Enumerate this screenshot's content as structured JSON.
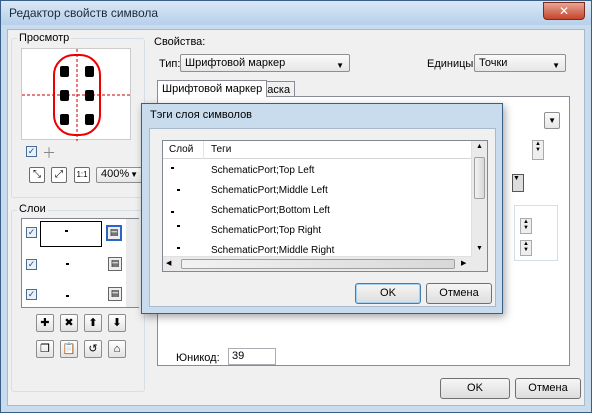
{
  "window": {
    "title": "Редактор свойств символа",
    "close_glyph": "✕"
  },
  "preview": {
    "label": "Просмотр",
    "zoom": "400%",
    "fit_glyph": "1:1"
  },
  "layers": {
    "label": "Слои"
  },
  "properties": {
    "label": "Свойства:",
    "type_label": "Тип:",
    "type_value": "Шрифтовой маркер",
    "units_label": "Единицы:",
    "units_value": "Точки",
    "tabs": [
      "Шрифтовой маркер",
      "Маска"
    ],
    "unicode_label": "Юникод:",
    "unicode_value": "39"
  },
  "footer": {
    "ok": "OK",
    "cancel": "Отмена"
  },
  "dialog": {
    "title": "Тэги слоя символов",
    "columns": [
      "Слой",
      "Теги"
    ],
    "rows": [
      {
        "tag": "SchematicPort;Top Left"
      },
      {
        "tag": "SchematicPort;Middle Left"
      },
      {
        "tag": "SchematicPort;Bottom Left"
      },
      {
        "tag": "SchematicPort;Top Right"
      },
      {
        "tag": "SchematicPort;Middle Right"
      }
    ],
    "ok": "OK",
    "cancel": "Отмена"
  },
  "colors": {
    "accent": "#e00000",
    "frame": "#3a5f86"
  }
}
